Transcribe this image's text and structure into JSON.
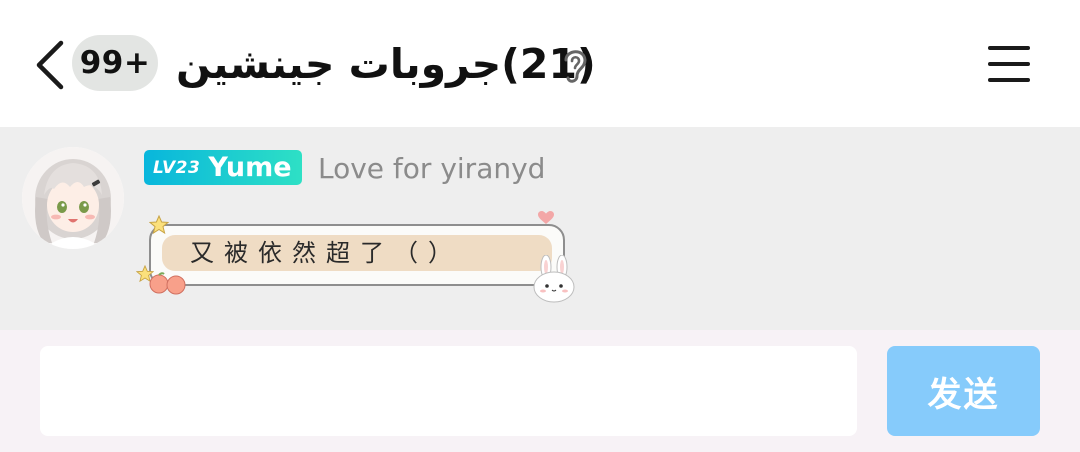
{
  "header": {
    "back_icon": "chevron-left-icon",
    "unread_badge": "99+",
    "title": "(21)جروبات جينشين",
    "listen_icon": "ear-icon",
    "menu_icon": "hamburger-menu-icon"
  },
  "message": {
    "level_badge": "LV23",
    "username": "Yume",
    "tagline": "Love for yiranyd",
    "text": "又被依然超了（）",
    "bubble_colors": {
      "fill": "#efdcc4",
      "frame": "#8e8e8e"
    }
  },
  "composer": {
    "input_value": "",
    "input_placeholder": "",
    "send_label": "发送",
    "send_color": "#86cbfb"
  }
}
